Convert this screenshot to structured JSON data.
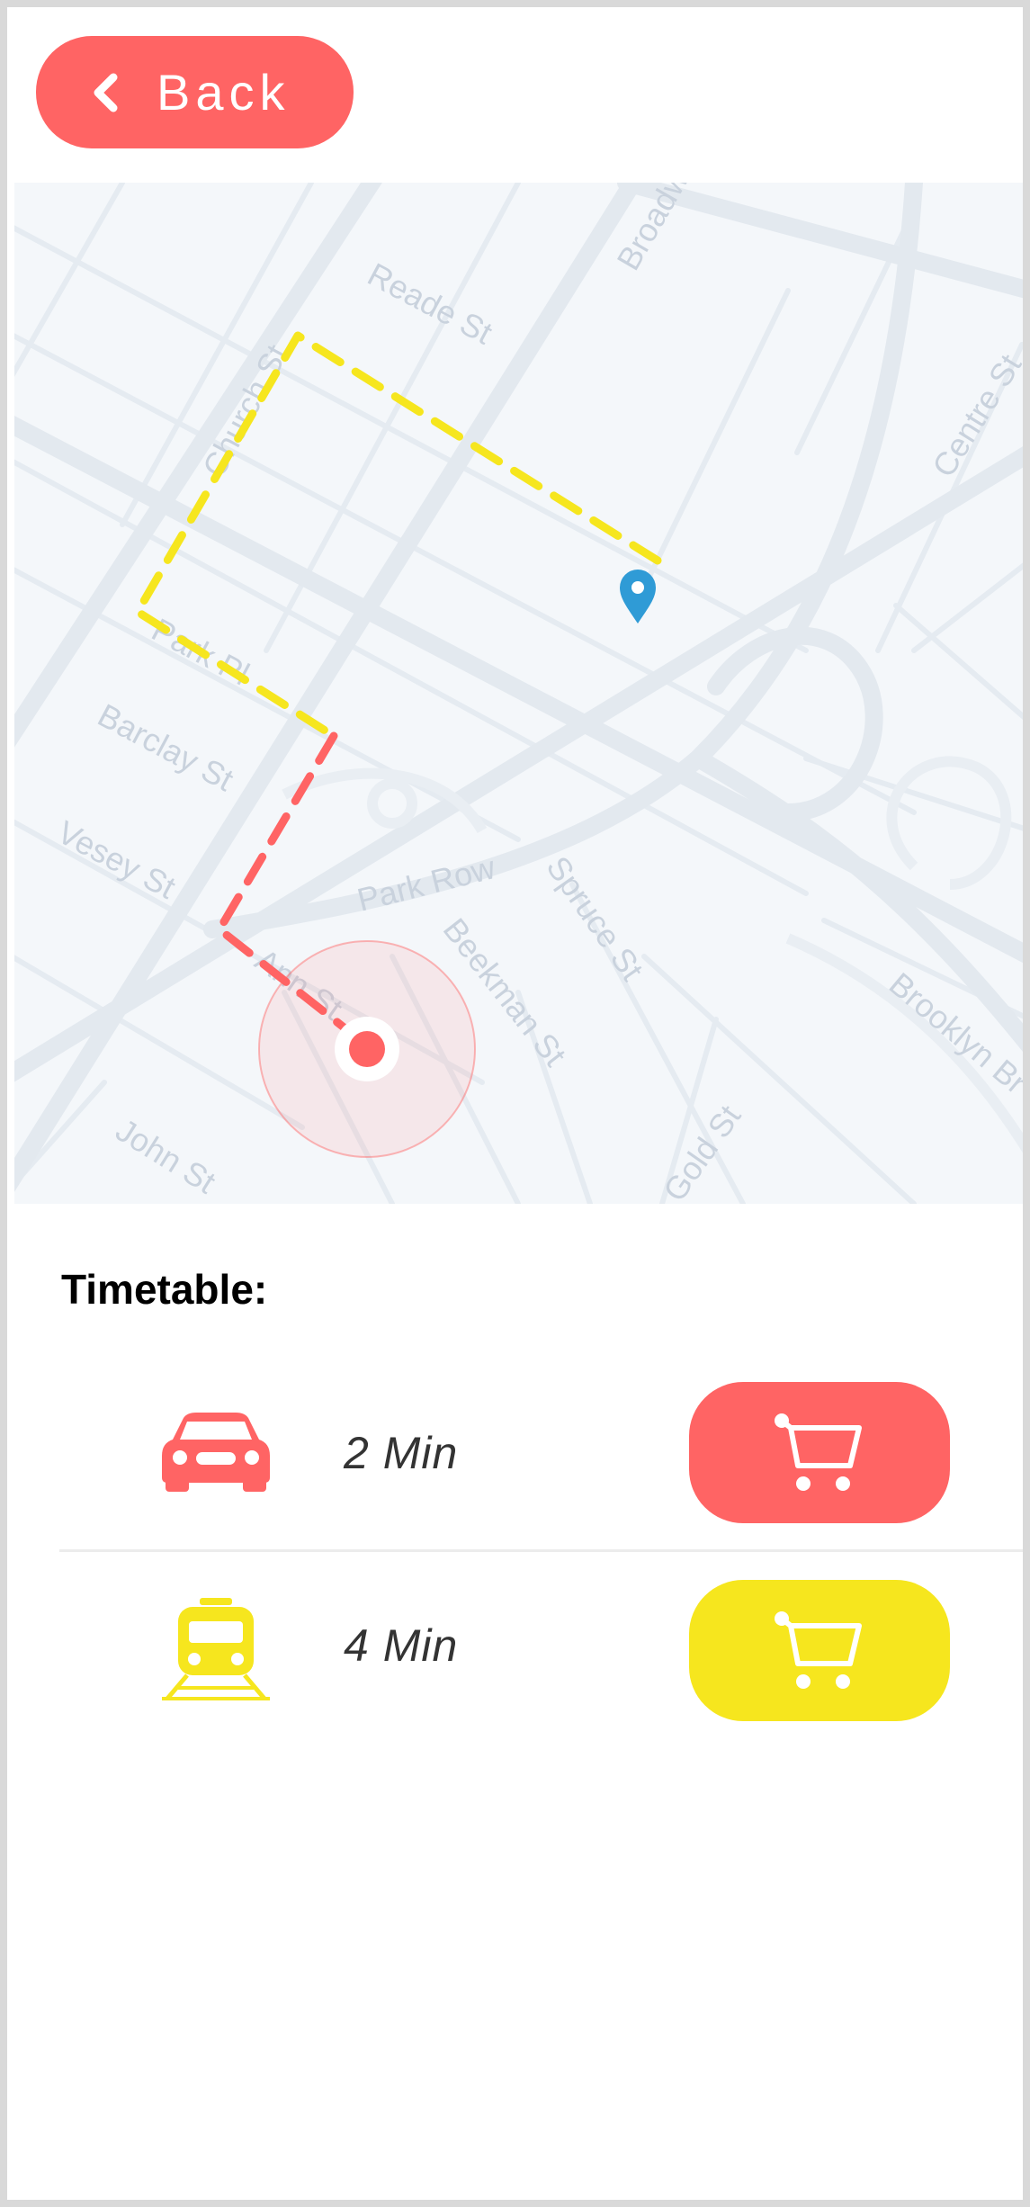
{
  "header": {
    "back_label": "Back",
    "back_icon": "chevron-left-icon"
  },
  "map": {
    "street_labels": [
      "Reade St",
      "Broadway",
      "Church St",
      "Centre St",
      "Park Pl",
      "Barclay St",
      "Vesey St",
      "Park Row",
      "Spruce St",
      "Beekman St",
      "Ann St",
      "Brooklyn Br",
      "John St",
      "Gold St"
    ],
    "route_colors": {
      "walk_segment": "#f6e61e",
      "ride_segment": "#ff6464"
    },
    "destination_icon": "map-pin-icon",
    "destination_color": "#2f9bd6",
    "current_location_icon": "current-location-icon"
  },
  "timetable": {
    "title": "Timetable:",
    "rows": [
      {
        "vehicle": "car-icon",
        "time": "2 Min",
        "color": "#ff6464",
        "action_icon": "cart-icon"
      },
      {
        "vehicle": "train-icon",
        "time": "4 Min",
        "color": "#f6e61e",
        "action_icon": "cart-icon"
      }
    ]
  }
}
